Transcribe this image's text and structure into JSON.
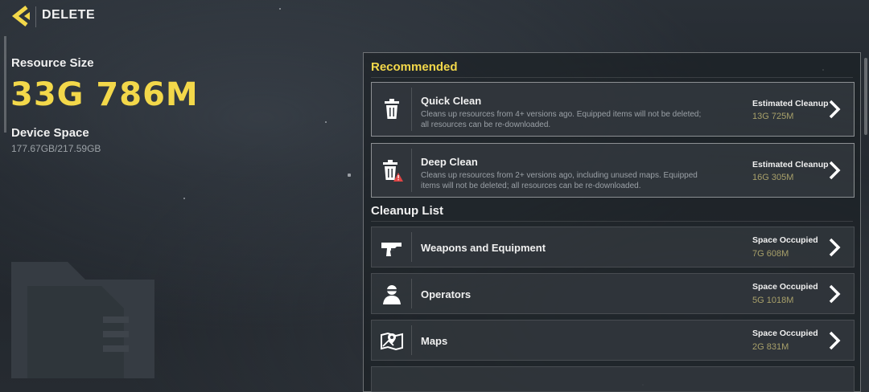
{
  "header": {
    "title": "DELETE"
  },
  "summary": {
    "resource_label": "Resource Size",
    "resource_value": "33G 786M",
    "device_label": "Device Space",
    "device_value": "177.67GB/217.59GB"
  },
  "recommended": {
    "title": "Recommended",
    "items": [
      {
        "name": "Quick Clean",
        "desc": "Cleans up resources from 4+ versions ago. Equipped items will not be deleted; all resources can be re-downloaded.",
        "meta_label": "Estimated Cleanup",
        "meta_value": "13G 725M",
        "icon": "trash-icon"
      },
      {
        "name": "Deep Clean",
        "desc": "Cleans up resources from 2+ versions ago, including unused maps. Equipped items will not be deleted; all resources can be re-downloaded.",
        "meta_label": "Estimated Cleanup",
        "meta_value": "16G 305M",
        "icon": "trash-warning-icon"
      }
    ]
  },
  "cleanup": {
    "title": "Cleanup List",
    "items": [
      {
        "name": "Weapons and Equipment",
        "meta_label": "Space Occupied",
        "meta_value": "7G 608M",
        "icon": "pistol-icon"
      },
      {
        "name": "Operators",
        "meta_label": "Space Occupied",
        "meta_value": "5G 1018M",
        "icon": "operator-icon"
      },
      {
        "name": "Maps",
        "meta_label": "Space Occupied",
        "meta_value": "2G 831M",
        "icon": "map-icon"
      }
    ]
  },
  "colors": {
    "accent": "#f3d84a",
    "value_text": "#a8a06a"
  }
}
